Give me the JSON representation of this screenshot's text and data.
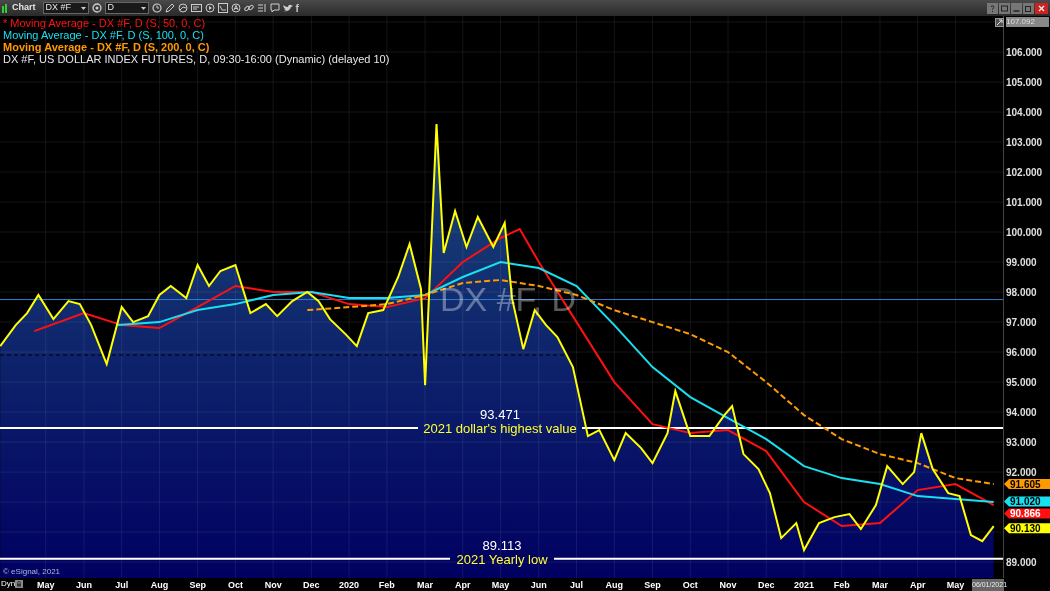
{
  "window": {
    "title": "Chart",
    "symbol": "DX #F",
    "interval": "D",
    "facebook_glyph": "f"
  },
  "watermark_symbol": "DX #F, D",
  "axis_top_value": "107.092",
  "copyright": "© eSignal, 2021",
  "dyn_button": "Dyn",
  "current_date": "06/01/2021",
  "legend_styles": [
    {
      "bold": false
    },
    {
      "bold": false
    },
    {
      "bold": true
    },
    {
      "bold": false
    }
  ],
  "price_tags": [
    {
      "text": "91.605",
      "color": "#ff9a00"
    },
    {
      "text": "91.020",
      "color": "#18e0f0"
    },
    {
      "text": "90.866",
      "color": "#ff1010"
    },
    {
      "text": "90.130",
      "color": "#ffff00"
    }
  ],
  "levels": [
    {
      "value": "93.471",
      "caption": "2021 dollar's highest value"
    },
    {
      "value": "89.113",
      "caption": "2021 Yearly low"
    }
  ],
  "chart_data": {
    "type": "line",
    "grid": true,
    "ref_lines": [
      {
        "axis": "y",
        "value": 97.75,
        "color": "#2a7fd0",
        "line_style": "solid"
      },
      {
        "axis": "y",
        "value": 95.9,
        "color": "#000000",
        "line_style": "dashed"
      }
    ],
    "ylim": [
      88.47,
      107.2
    ],
    "xlim": [
      2019.2325,
      2021.4375
    ],
    "yticks": [
      {
        "value": 89,
        "label": "89.000"
      },
      {
        "value": 92,
        "label": "92.000"
      },
      {
        "value": 93,
        "label": "93.000"
      },
      {
        "value": 94,
        "label": "94.000"
      },
      {
        "value": 95,
        "label": "95.000"
      },
      {
        "value": 96,
        "label": "96.000"
      },
      {
        "value": 97,
        "label": "97.000"
      },
      {
        "value": 98,
        "label": "98.000"
      },
      {
        "value": 99,
        "label": "99.000"
      },
      {
        "value": 100,
        "label": "100.000"
      },
      {
        "value": 101,
        "label": "101.000"
      },
      {
        "value": 102,
        "label": "102.000"
      },
      {
        "value": 103,
        "label": "103.000"
      },
      {
        "value": 104,
        "label": "104.000"
      },
      {
        "value": 105,
        "label": "105.000"
      },
      {
        "value": 106,
        "label": "106.000"
      }
    ],
    "xticks": [
      {
        "value": 2019.333,
        "label": "May"
      },
      {
        "value": 2019.417,
        "label": "Jun"
      },
      {
        "value": 2019.5,
        "label": "Jul"
      },
      {
        "value": 2019.583,
        "label": "Aug"
      },
      {
        "value": 2019.667,
        "label": "Sep"
      },
      {
        "value": 2019.75,
        "label": "Oct"
      },
      {
        "value": 2019.833,
        "label": "Nov"
      },
      {
        "value": 2019.917,
        "label": "Dec"
      },
      {
        "value": 2020,
        "label": "2020"
      },
      {
        "value": 2020.083,
        "label": "Feb"
      },
      {
        "value": 2020.167,
        "label": "Mar"
      },
      {
        "value": 2020.25,
        "label": "Apr"
      },
      {
        "value": 2020.333,
        "label": "May"
      },
      {
        "value": 2020.417,
        "label": "Jun"
      },
      {
        "value": 2020.5,
        "label": "Jul"
      },
      {
        "value": 2020.583,
        "label": "Aug"
      },
      {
        "value": 2020.667,
        "label": "Sep"
      },
      {
        "value": 2020.75,
        "label": "Oct"
      },
      {
        "value": 2020.833,
        "label": "Nov"
      },
      {
        "value": 2020.917,
        "label": "Dec"
      },
      {
        "value": 2021,
        "label": "2021"
      },
      {
        "value": 2021.083,
        "label": "Feb"
      },
      {
        "value": 2021.167,
        "label": "Mar"
      },
      {
        "value": 2021.25,
        "label": "Apr"
      },
      {
        "value": 2021.333,
        "label": "May"
      }
    ],
    "series": [
      {
        "name": "* Moving Average - DX #F, D (S, 50, 0, C)",
        "color": "#ff1010",
        "x": [
          2019.308,
          2019.417,
          2019.5,
          2019.583,
          2019.667,
          2019.75,
          2019.833,
          2019.917,
          2020.0,
          2020.083,
          2020.167,
          2020.25,
          2020.333,
          2020.375,
          2020.417,
          2020.5,
          2020.583,
          2020.667,
          2020.75,
          2020.833,
          2020.917,
          2021.0,
          2021.083,
          2021.167,
          2021.25,
          2021.333,
          2021.417
        ],
        "values": [
          96.7,
          97.3,
          96.9,
          96.8,
          97.5,
          98.2,
          98.0,
          98.0,
          97.6,
          97.5,
          97.8,
          99.0,
          99.8,
          100.1,
          99.0,
          97.0,
          95.0,
          93.6,
          93.3,
          93.4,
          92.7,
          91.0,
          90.2,
          90.3,
          91.4,
          91.6,
          90.9
        ]
      },
      {
        "name": "Moving Average - DX #F, D (S, 100, 0, C)",
        "color": "#18e0f0",
        "x": [
          2019.492,
          2019.583,
          2019.667,
          2019.75,
          2019.833,
          2019.917,
          2020.0,
          2020.083,
          2020.167,
          2020.25,
          2020.333,
          2020.417,
          2020.5,
          2020.583,
          2020.667,
          2020.75,
          2020.833,
          2020.917,
          2021.0,
          2021.083,
          2021.167,
          2021.25,
          2021.333,
          2021.417
        ],
        "values": [
          96.9,
          97.0,
          97.4,
          97.6,
          97.9,
          98.0,
          97.8,
          97.8,
          97.9,
          98.5,
          99.0,
          98.8,
          98.2,
          96.9,
          95.5,
          94.5,
          93.8,
          93.1,
          92.2,
          91.8,
          91.6,
          91.2,
          91.1,
          91.0
        ]
      },
      {
        "name": "Moving Average - DX #F, D (S, 200, 0, C)",
        "color": "#ff9a00",
        "line_style": "dashed",
        "x": [
          2019.908,
          2020.0,
          2020.083,
          2020.167,
          2020.25,
          2020.333,
          2020.417,
          2020.5,
          2020.583,
          2020.667,
          2020.75,
          2020.833,
          2020.917,
          2021.0,
          2021.083,
          2021.167,
          2021.25,
          2021.333,
          2021.417
        ],
        "values": [
          97.4,
          97.5,
          97.6,
          97.9,
          98.3,
          98.4,
          98.2,
          97.9,
          97.4,
          97.0,
          96.6,
          96.0,
          95.0,
          93.9,
          93.1,
          92.6,
          92.3,
          91.8,
          91.6
        ]
      },
      {
        "name": "DX #F, US DOLLAR INDEX FUTURES, D, 09:30-16:00 (Dynamic) (delayed 10)",
        "color": "#ffff00",
        "type": "area",
        "x": [
          2019.233,
          2019.267,
          2019.292,
          2019.317,
          2019.35,
          2019.383,
          2019.408,
          2019.433,
          2019.467,
          2019.5,
          2019.525,
          2019.558,
          2019.583,
          2019.608,
          2019.642,
          2019.667,
          2019.692,
          2019.717,
          2019.75,
          2019.783,
          2019.817,
          2019.842,
          2019.875,
          2019.908,
          2019.933,
          2019.958,
          2019.992,
          2020.017,
          2020.042,
          2020.075,
          2020.108,
          2020.133,
          2020.158,
          2020.167,
          2020.192,
          2020.208,
          2020.233,
          2020.258,
          2020.283,
          2020.317,
          2020.342,
          2020.358,
          2020.383,
          2020.408,
          2020.433,
          2020.458,
          2020.492,
          2020.525,
          2020.55,
          2020.583,
          2020.608,
          2020.642,
          2020.667,
          2020.7,
          2020.717,
          2020.75,
          2020.792,
          2020.825,
          2020.842,
          2020.867,
          2020.9,
          2020.925,
          2020.95,
          2020.983,
          2021.0,
          2021.033,
          2021.067,
          2021.1,
          2021.125,
          2021.158,
          2021.183,
          2021.217,
          2021.242,
          2021.258,
          2021.283,
          2021.317,
          2021.342,
          2021.367,
          2021.392,
          2021.417
        ],
        "values": [
          96.2,
          96.9,
          97.3,
          97.9,
          97.1,
          97.7,
          97.6,
          96.9,
          95.6,
          97.5,
          97.0,
          97.2,
          97.9,
          98.2,
          97.8,
          98.9,
          98.2,
          98.7,
          98.9,
          97.3,
          97.6,
          97.2,
          97.7,
          98.0,
          97.7,
          97.1,
          96.6,
          96.2,
          97.3,
          97.4,
          98.5,
          99.6,
          98.1,
          94.9,
          103.6,
          99.3,
          100.7,
          99.5,
          100.5,
          99.5,
          100.3,
          97.8,
          96.1,
          97.4,
          96.9,
          96.5,
          95.5,
          93.2,
          93.4,
          92.4,
          93.3,
          92.8,
          92.3,
          93.3,
          94.7,
          93.2,
          93.2,
          93.9,
          94.2,
          92.6,
          92.1,
          91.3,
          89.8,
          90.3,
          89.4,
          90.3,
          90.5,
          90.6,
          90.1,
          90.9,
          92.2,
          91.6,
          92.0,
          93.3,
          92.1,
          91.3,
          91.2,
          89.9,
          89.7,
          90.2
        ]
      }
    ]
  }
}
